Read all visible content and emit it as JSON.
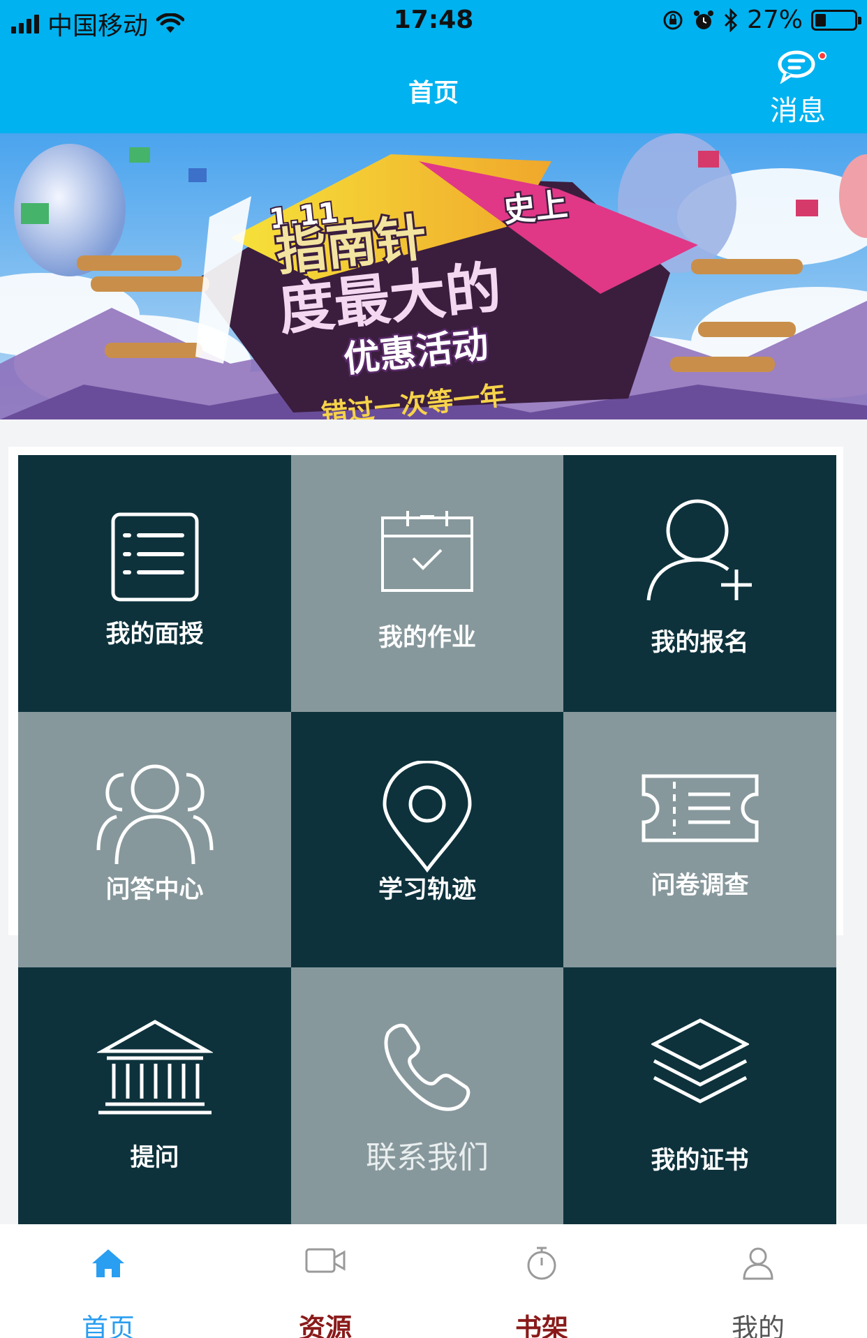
{
  "status_bar": {
    "carrier": "中国移动",
    "time": "17:48",
    "battery": "27%",
    "battery_level": 0.27
  },
  "header": {
    "title": "首页",
    "message_label": "消息",
    "has_unread": true
  },
  "banner": {
    "badge": "1.11",
    "line1": "指南针",
    "line1b": "史上",
    "line2": "度最大的",
    "line3": "优惠活动",
    "line4": "错过一次等一年"
  },
  "grid": [
    {
      "label": "我的面授",
      "icon": "list-icon",
      "tone": "dark"
    },
    {
      "label": "我的作业",
      "icon": "calendar-check-icon",
      "tone": "light"
    },
    {
      "label": "我的报名",
      "icon": "user-add-icon",
      "tone": "dark"
    },
    {
      "label": "问答中心",
      "icon": "group-icon",
      "tone": "light"
    },
    {
      "label": "学习轨迹",
      "icon": "location-pin-icon",
      "tone": "dark"
    },
    {
      "label": "问卷调查",
      "icon": "ticket-icon",
      "tone": "light"
    },
    {
      "label": "提问",
      "icon": "bank-icon",
      "tone": "dark"
    },
    {
      "label": "联系我们",
      "icon": "phone-icon",
      "tone": "light"
    },
    {
      "label": "我的证书",
      "icon": "layers-icon",
      "tone": "dark"
    }
  ],
  "tabs": [
    {
      "label": "首页",
      "icon": "home-icon",
      "color": "#2a9ef0"
    },
    {
      "label": "资源",
      "icon": "video-icon",
      "color": "#8a1a1a"
    },
    {
      "label": "书架",
      "icon": "stopwatch-icon",
      "color": "#8a1a1a"
    },
    {
      "label": "我的",
      "icon": "person-icon",
      "color": "#555555"
    }
  ],
  "colors": {
    "header_bg": "#00b2f0",
    "tile_dark": "#0d323c",
    "tile_light": "#87989c"
  }
}
